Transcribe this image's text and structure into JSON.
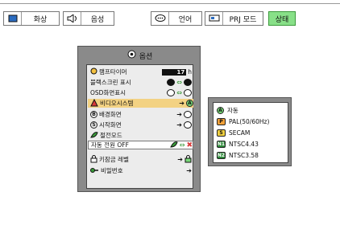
{
  "tabs": [
    {
      "label": "화상",
      "icon": "picture-icon"
    },
    {
      "label": "음성",
      "icon": "speaker-icon"
    },
    {
      "label": "언어",
      "icon": "speech-bubble-icon"
    },
    {
      "label": "PRJ 모드",
      "icon": "projector-icon"
    },
    {
      "label": "상태",
      "active": true
    }
  ],
  "menu": {
    "title": "옵션",
    "rows": [
      {
        "label": "램프타이머",
        "value": "17",
        "unit": "h"
      },
      {
        "label": "블랙스크린 표시"
      },
      {
        "label": "OSD화면표시"
      },
      {
        "label": "비디오시스템"
      },
      {
        "label": "배경화면"
      },
      {
        "label": "시작화면"
      },
      {
        "label": "절전모드"
      },
      {
        "label": "자동 전원 OFF"
      },
      {
        "label": "키잠금 레벨"
      },
      {
        "label": "비밀번호"
      }
    ]
  },
  "submenu": {
    "items": [
      {
        "badge": "",
        "label": "자동"
      },
      {
        "badge": "P",
        "label": "PAL(50/60Hz)"
      },
      {
        "badge": "S",
        "label": "SECAM"
      },
      {
        "badge": "N1",
        "label": "NTSC4.43"
      },
      {
        "badge": "N2",
        "label": "NTSC3.58"
      }
    ]
  },
  "colors": {
    "highlight": "#f3d283",
    "active_tab": "#88e088",
    "panel": "#8a8a8a"
  }
}
